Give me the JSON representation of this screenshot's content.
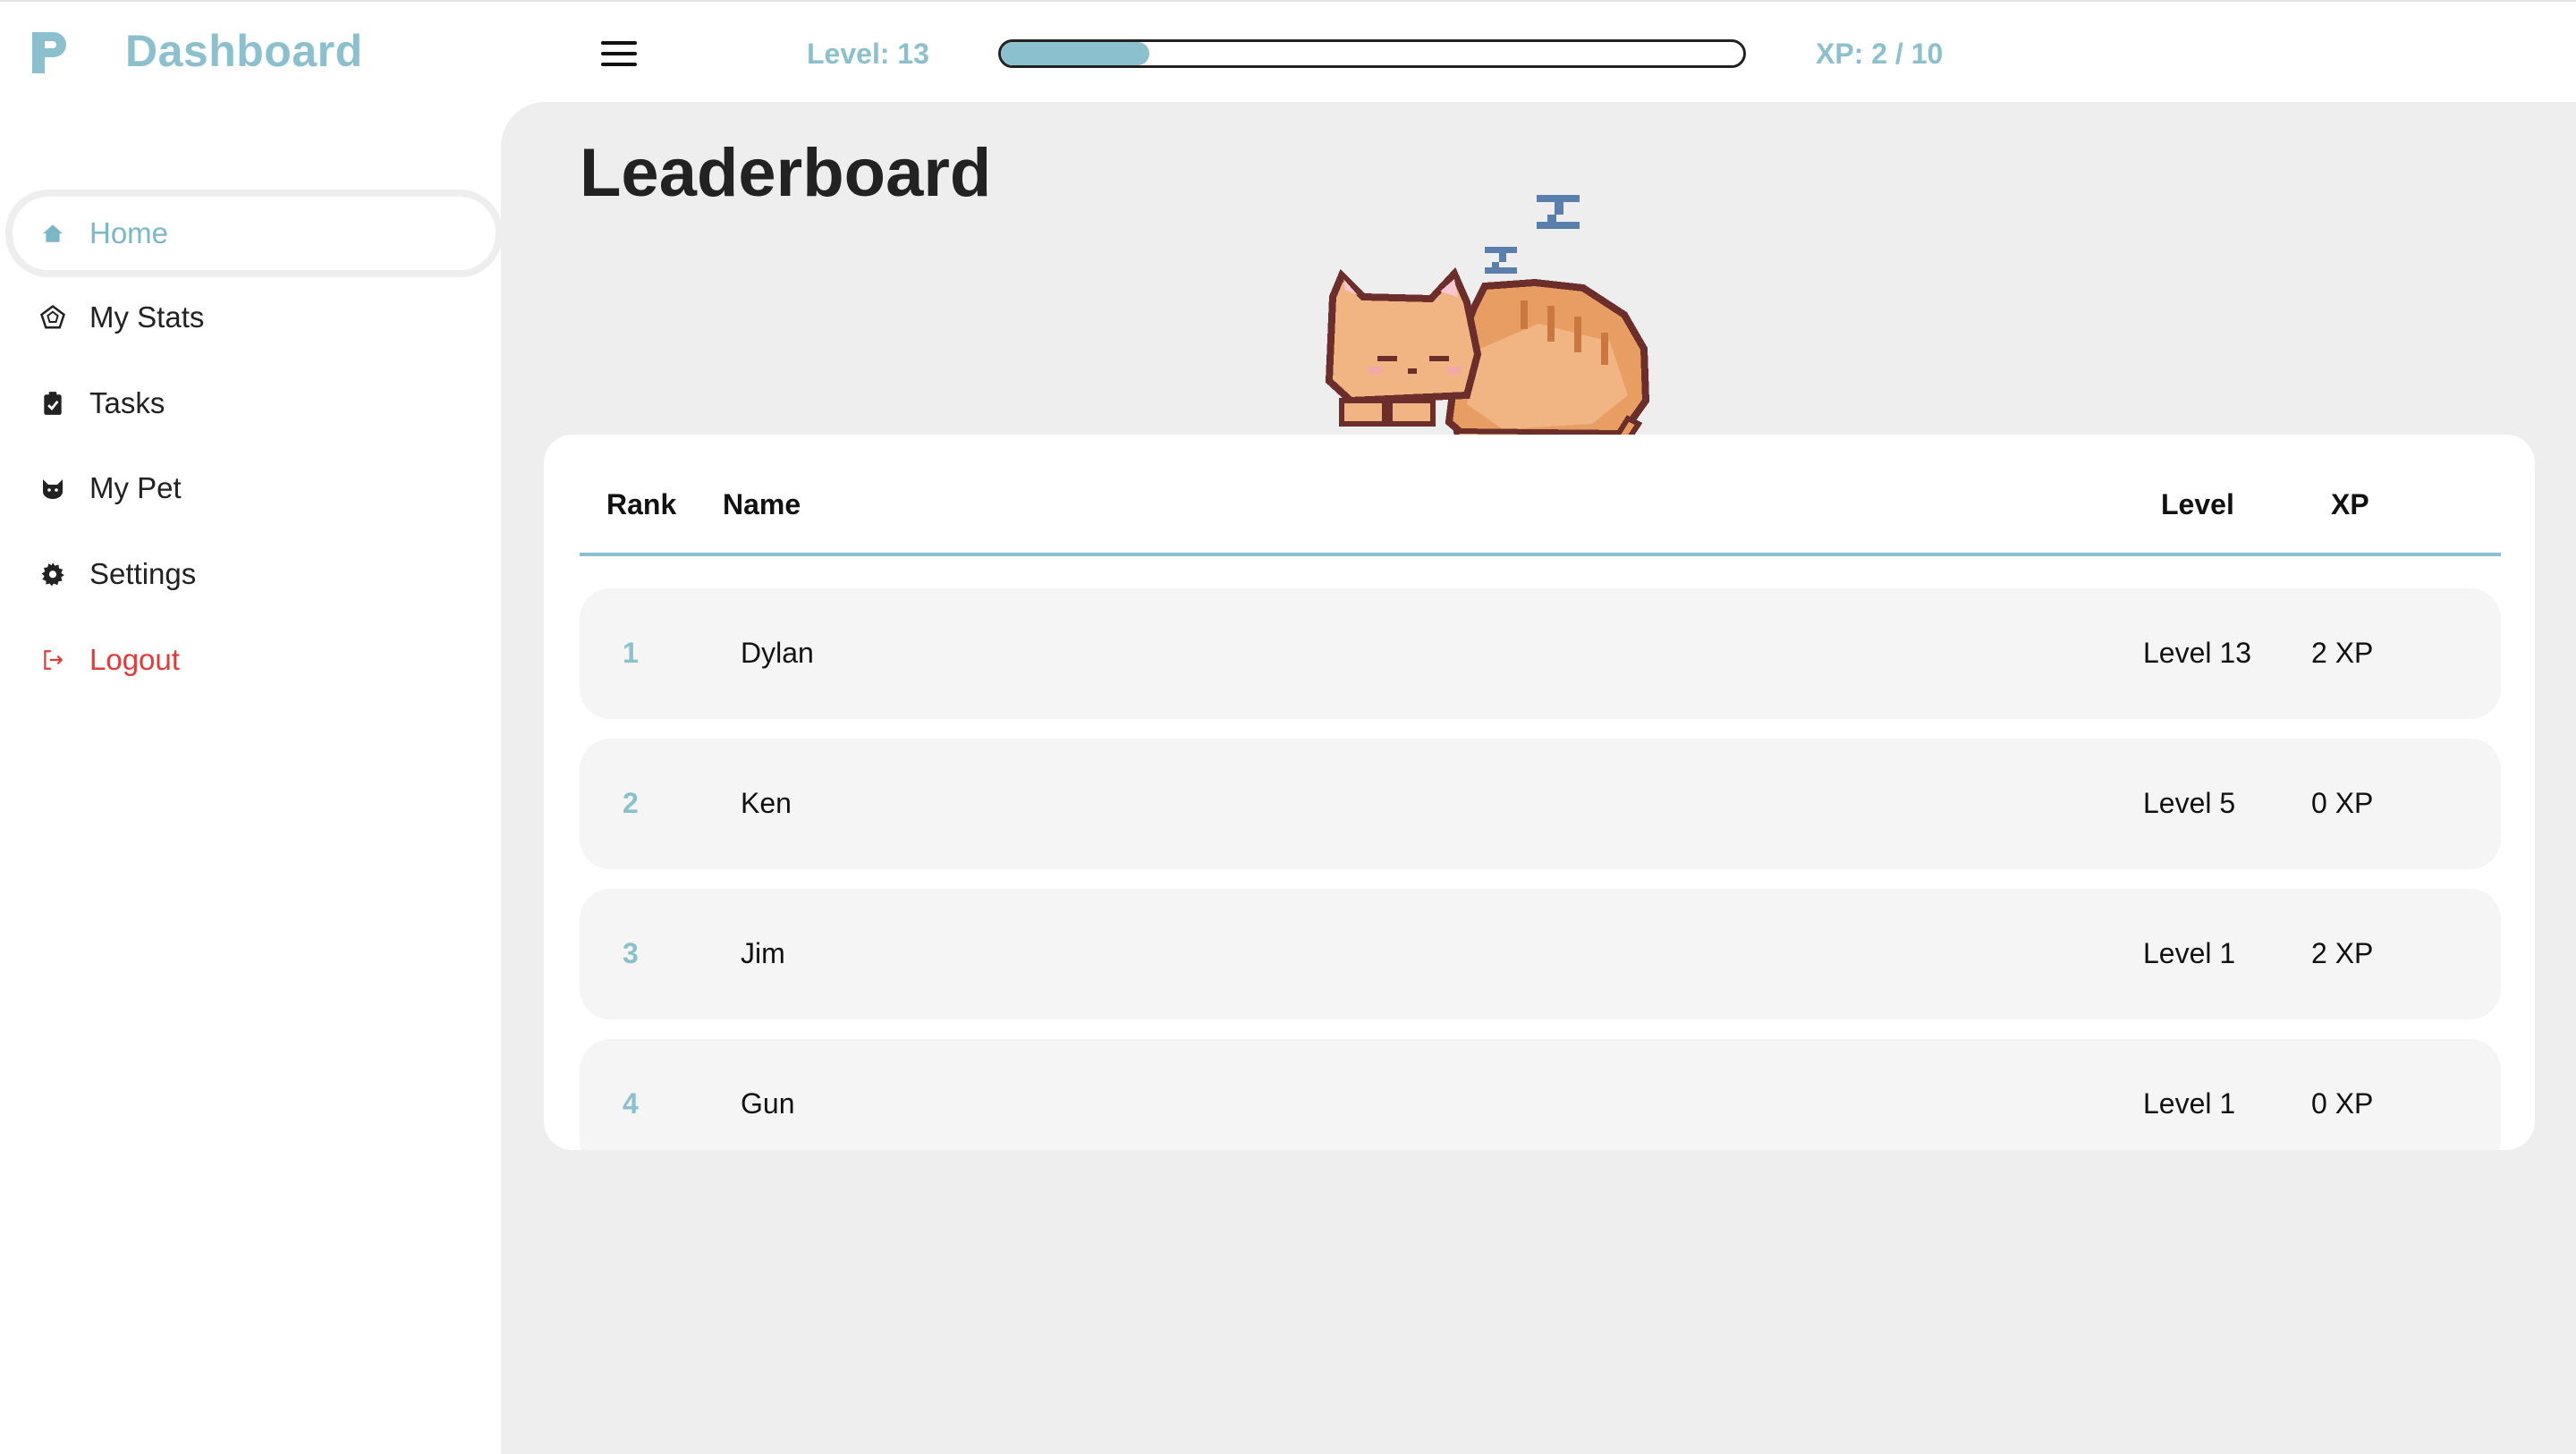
{
  "app": {
    "brand": "Dashboard",
    "accent_color": "#8bc0ce",
    "logout_color": "#e53935"
  },
  "header": {
    "level_label": "Level: 13",
    "xp_label": "XP: 2 / 10",
    "xp_progress": 0.2,
    "menu_icon": "hamburger-icon"
  },
  "sidebar": {
    "items": [
      {
        "label": "Home",
        "icon": "home-icon",
        "active": true
      },
      {
        "label": "My Stats",
        "icon": "pentagon-stats-icon"
      },
      {
        "label": "Tasks",
        "icon": "clipboard-check-icon"
      },
      {
        "label": "My Pet",
        "icon": "cat-face-icon"
      },
      {
        "label": "Settings",
        "icon": "gear-icon"
      },
      {
        "label": "Logout",
        "icon": "logout-icon"
      }
    ]
  },
  "page": {
    "title": "Leaderboard",
    "pet_image": "sleeping-cat"
  },
  "leaderboard": {
    "columns": [
      "Rank",
      "Name",
      "Level",
      "XP"
    ],
    "rows": [
      {
        "rank": "1",
        "name": "Dylan",
        "level": "Level 13",
        "xp": "2 XP"
      },
      {
        "rank": "2",
        "name": "Ken",
        "level": "Level 5",
        "xp": "0 XP"
      },
      {
        "rank": "3",
        "name": "Jim",
        "level": "Level 1",
        "xp": "2 XP"
      },
      {
        "rank": "4",
        "name": "Gun",
        "level": "Level 1",
        "xp": "0 XP"
      }
    ]
  }
}
